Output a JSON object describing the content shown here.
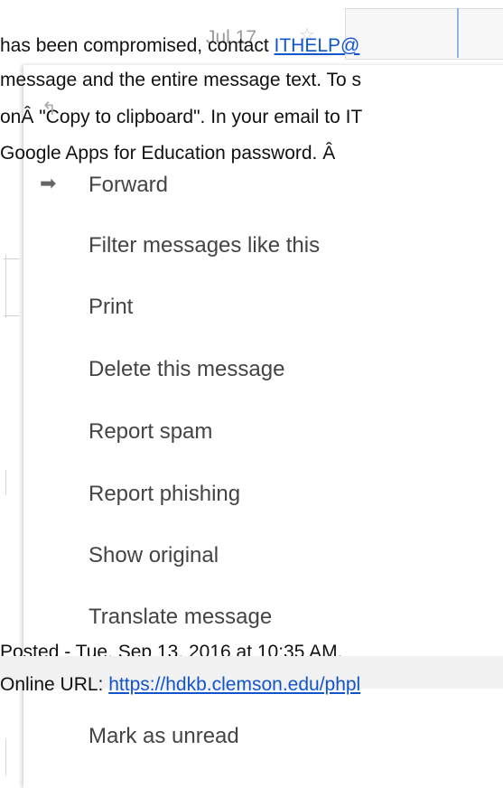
{
  "article": {
    "line1_pre": "has been compromised, contact ",
    "line1_link": "ITHELP@",
    "line2": "message and the entire message text. To s",
    "line3": "onÂ \"Copy to clipboard\". In your email to IT",
    "line4": "Google Apps for Education password. Â"
  },
  "background_message": {
    "date": "Jul 17",
    "reply_label": "Reply"
  },
  "menu": {
    "items": [
      {
        "label": "Forward"
      },
      {
        "label": "Filter messages like this"
      },
      {
        "label": "Print"
      },
      {
        "label": "Delete this message"
      },
      {
        "label": "Report spam"
      },
      {
        "label": "Report phishing"
      },
      {
        "label": "Show original"
      },
      {
        "label": "Translate message"
      },
      {
        "label": "Mark as unread"
      }
    ]
  },
  "footer": {
    "posted": "Posted - Tue, Sep 13, 2016 at 10:35 AM.",
    "url_label": "Online URL: ",
    "url_link": "https://hdkb.clemson.edu/phpl"
  }
}
